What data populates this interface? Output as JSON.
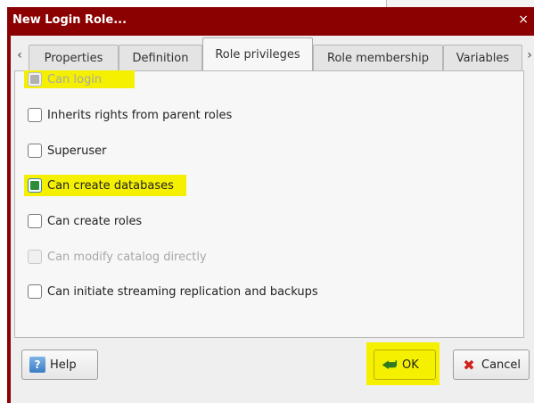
{
  "window": {
    "title": "New Login Role...",
    "close_glyph": "×"
  },
  "tabs": {
    "scroll_left": "‹",
    "scroll_right": "›",
    "items": [
      {
        "label": "Properties"
      },
      {
        "label": "Definition"
      },
      {
        "label": "Role privileges"
      },
      {
        "label": "Role membership"
      },
      {
        "label": "Variables"
      }
    ],
    "active": "Role privileges"
  },
  "privileges": [
    {
      "label": "Can login",
      "checked": true,
      "enabled": false
    },
    {
      "label": "Inherits rights from parent roles",
      "checked": false,
      "enabled": true
    },
    {
      "label": "Superuser",
      "checked": false,
      "enabled": true
    },
    {
      "label": "Can create databases",
      "checked": true,
      "enabled": true
    },
    {
      "label": "Can create roles",
      "checked": false,
      "enabled": true
    },
    {
      "label": "Can modify catalog directly",
      "checked": false,
      "enabled": false
    },
    {
      "label": "Can initiate streaming replication and backups",
      "checked": false,
      "enabled": true
    }
  ],
  "buttons": {
    "help": {
      "label": "Help",
      "icon": "help-icon"
    },
    "ok": {
      "label": "OK",
      "icon": "ok-arrow-icon"
    },
    "cancel": {
      "label": "Cancel",
      "icon": "cancel-x-icon"
    }
  },
  "colors": {
    "titlebar": "#8b0000",
    "highlight": "#f4f000",
    "checked": "#2e8b3a"
  }
}
